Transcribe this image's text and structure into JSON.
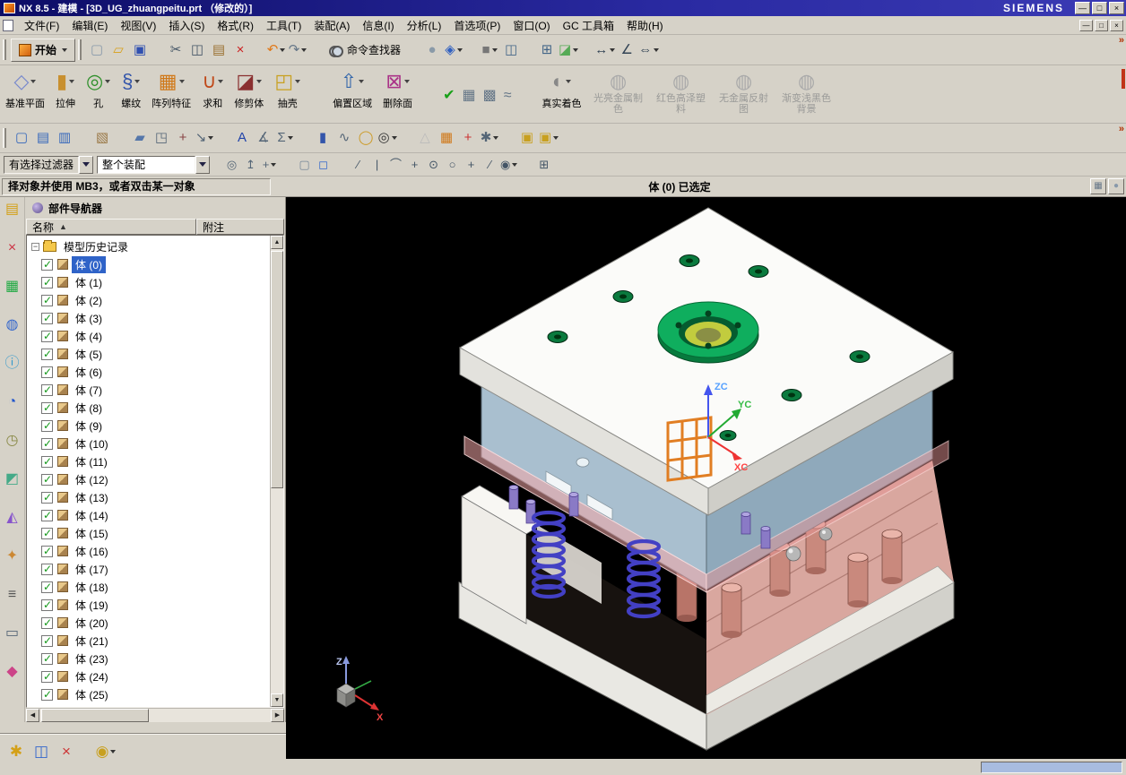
{
  "titlebar": {
    "title": "NX 8.5 - 建模 - [3D_UG_zhuangpeitu.prt （修改的）]",
    "brand": "SIEMENS",
    "minimize_glyph": "—",
    "maximize_glyph": "□",
    "close_glyph": "×"
  },
  "mdi": {
    "minimize_glyph": "—",
    "restore_glyph": "□",
    "close_glyph": "×"
  },
  "chrome": {
    "overflow_glyph": "»"
  },
  "scroll": {
    "up": "▲",
    "down": "▼",
    "left": "◀",
    "right": "▶"
  },
  "menubar": {
    "items": [
      {
        "label": "文件(F)",
        "name": "menu-file"
      },
      {
        "label": "编辑(E)",
        "name": "menu-edit"
      },
      {
        "label": "视图(V)",
        "name": "menu-view"
      },
      {
        "label": "插入(S)",
        "name": "menu-insert"
      },
      {
        "label": "格式(R)",
        "name": "menu-format"
      },
      {
        "label": "工具(T)",
        "name": "menu-tools"
      },
      {
        "label": "装配(A)",
        "name": "menu-assemblies"
      },
      {
        "label": "信息(I)",
        "name": "menu-information"
      },
      {
        "label": "分析(L)",
        "name": "menu-analysis"
      },
      {
        "label": "首选项(P)",
        "name": "menu-preferences"
      },
      {
        "label": "窗口(O)",
        "name": "menu-window"
      },
      {
        "label": "GC 工具箱",
        "name": "menu-gc-toolbox"
      },
      {
        "label": "帮助(H)",
        "name": "menu-help"
      }
    ]
  },
  "standard_toolbar": {
    "start_label": "开始",
    "command_finder_label": "命令查找器",
    "icons_left": [
      {
        "name": "new-file-icon",
        "glyph": "▢",
        "color": "#8899aa"
      },
      {
        "name": "open-folder-icon",
        "glyph": "▱",
        "color": "#d8a018"
      },
      {
        "name": "save-icon",
        "glyph": "▣",
        "color": "#3050b0"
      },
      {
        "name": "cut-icon",
        "glyph": "✂",
        "color": "#445566",
        "gap": true
      },
      {
        "name": "copy-icon",
        "glyph": "◫",
        "color": "#445566"
      },
      {
        "name": "paste-icon",
        "glyph": "▤",
        "color": "#9a7030"
      },
      {
        "name": "delete-icon",
        "glyph": "×",
        "color": "#cc2020"
      },
      {
        "name": "undo-icon",
        "glyph": "↶",
        "color": "#e07818",
        "caret": true,
        "gap": true
      },
      {
        "name": "redo-icon",
        "glyph": "↷",
        "color": "#667788",
        "caret": true
      }
    ],
    "icons_right": [
      {
        "name": "selection-sphere-icon",
        "glyph": "●",
        "color": "#8a9aa8",
        "gap": true
      },
      {
        "name": "view-orient-icon",
        "glyph": "◈",
        "color": "#3060c0",
        "caret": true
      },
      {
        "name": "render-style-icon",
        "glyph": "■",
        "color": "#777777",
        "caret": true,
        "gap": true
      },
      {
        "name": "window-split-icon",
        "glyph": "◫",
        "color": "#446688"
      },
      {
        "name": "fit-view-icon",
        "glyph": "⊞",
        "color": "#446688",
        "gap": true
      },
      {
        "name": "section-view-icon",
        "glyph": "◪",
        "color": "#55aa55",
        "caret": true
      },
      {
        "name": "measure-distance-icon",
        "glyph": "↔",
        "color": "#334455",
        "caret": true,
        "gap": true
      },
      {
        "name": "angle-icon",
        "glyph": "∠",
        "color": "#334455"
      },
      {
        "name": "dimension-icon",
        "glyph": "⇔",
        "color": "#334455",
        "caret": true
      }
    ]
  },
  "feature_toolbar": {
    "buttons": [
      {
        "name": "datum-plane-button",
        "label": "基准平面",
        "glyph": "◇",
        "color": "#7788cc"
      },
      {
        "name": "extrude-button",
        "label": "拉伸",
        "glyph": "▮",
        "color": "#c89030"
      },
      {
        "name": "hole-button",
        "label": "孔",
        "glyph": "◎",
        "color": "#30902c"
      },
      {
        "name": "thread-button",
        "label": "螺纹",
        "glyph": "§",
        "color": "#3355aa"
      },
      {
        "name": "pattern-feature-button",
        "label": "阵列特征",
        "glyph": "▦",
        "color": "#d07818"
      },
      {
        "name": "unite-button",
        "label": "求和",
        "glyph": "∪",
        "color": "#c04818"
      },
      {
        "name": "trim-body-button",
        "label": "修剪体",
        "glyph": "◪",
        "color": "#8a3030"
      },
      {
        "name": "shell-button",
        "label": "抽壳",
        "glyph": "◰",
        "color": "#c8a020"
      },
      {
        "name": "offset-region-button",
        "label": "偏置区域",
        "glyph": "⇧",
        "color": "#3366aa",
        "gap": true
      },
      {
        "name": "delete-face-button",
        "label": "删除面",
        "glyph": "⊠",
        "color": "#aa3388"
      },
      {
        "name": "approve-check-icon",
        "glyph": "✔",
        "color": "#18a018",
        "small": true,
        "gap": true
      },
      {
        "name": "sheet-grid-icon",
        "glyph": "▦",
        "color": "#667788",
        "small": true
      },
      {
        "name": "matrix-icon",
        "glyph": "▩",
        "color": "#667788",
        "small": true
      },
      {
        "name": "curve-group-icon",
        "glyph": "≈",
        "color": "#667788",
        "small": true
      },
      {
        "name": "true-shading-button",
        "label": "真实着色",
        "glyph": "◐",
        "color": "#888888",
        "gap": true
      },
      {
        "name": "metal-material-button",
        "label": "光亮金属制色",
        "glyph": "◍",
        "color": "#9a9a9a",
        "disabled": true
      },
      {
        "name": "red-plastic-button",
        "label": "红色高泽塑料",
        "glyph": "◍",
        "color": "#9a9a9a",
        "disabled": true
      },
      {
        "name": "no-reflection-button",
        "label": "无金属反射图",
        "glyph": "◍",
        "color": "#9a9a9a",
        "disabled": true
      },
      {
        "name": "gradient-background-button",
        "label": "渐变浅黑色背景",
        "glyph": "◍",
        "color": "#9a9a9a",
        "disabled": true
      }
    ]
  },
  "utility_toolbar": {
    "icons": [
      {
        "name": "view-window-icon",
        "glyph": "▢",
        "color": "#3366bb"
      },
      {
        "name": "layer-settings-icon",
        "glyph": "▤",
        "color": "#3366bb"
      },
      {
        "name": "layer-category-icon",
        "glyph": "▥",
        "color": "#3366bb"
      },
      {
        "name": "info-sheet-icon",
        "glyph": "▧",
        "color": "#997744",
        "gap": true
      },
      {
        "name": "plate-icon",
        "glyph": "▰",
        "color": "#5577aa",
        "gap": true
      },
      {
        "name": "crop-icon",
        "glyph": "◳",
        "color": "#556677"
      },
      {
        "name": "datum-small-icon",
        "glyph": "+",
        "color": "#884444"
      },
      {
        "name": "quick-dimension-icon",
        "glyph": "↘",
        "color": "#556677",
        "caret": true
      },
      {
        "name": "annotation-icon",
        "glyph": "A",
        "color": "#2244aa",
        "gap": true
      },
      {
        "name": "slope-icon",
        "glyph": "∡",
        "color": "#556677"
      },
      {
        "name": "sigma-grid-icon",
        "glyph": "Σ",
        "color": "#556677",
        "caret": true
      },
      {
        "name": "cylinder-icon",
        "glyph": "▮",
        "color": "#3355aa",
        "gap": true
      },
      {
        "name": "spring-icon",
        "glyph": "∿",
        "color": "#556677"
      },
      {
        "name": "torus-icon",
        "glyph": "◯",
        "color": "#cc9922"
      },
      {
        "name": "spiral-icon",
        "glyph": "◎",
        "color": "#333333",
        "caret": true
      },
      {
        "name": "triangle-mesh-icon",
        "glyph": "△",
        "color": "#bbbbbb",
        "gap": true
      },
      {
        "name": "table-icon",
        "glyph": "▦",
        "color": "#d07818"
      },
      {
        "name": "plus-red-icon",
        "glyph": "+",
        "color": "#cc3333"
      },
      {
        "name": "gears-icon",
        "glyph": "✱",
        "color": "#556677",
        "caret": true
      },
      {
        "name": "component-box-icon",
        "glyph": "▣",
        "color": "#c8a020",
        "gap": true
      },
      {
        "name": "component-box2-icon",
        "glyph": "▣",
        "color": "#c8a020",
        "caret": true
      }
    ]
  },
  "selection_bar": {
    "filter_label": "有选择过滤器",
    "scope_value": "整个装配",
    "icons": [
      {
        "name": "glasses-icon",
        "glyph": "◎",
        "color": "#556677"
      },
      {
        "name": "pick-top-icon",
        "glyph": "↥",
        "color": "#556677"
      },
      {
        "name": "crosshair-icon",
        "glyph": "+",
        "color": "#556677",
        "caret": true
      },
      {
        "name": "rounded-rect-icon",
        "glyph": "▢",
        "color": "#778899",
        "gap": true
      },
      {
        "name": "face-select-icon",
        "glyph": "◻",
        "color": "#3366cc"
      },
      {
        "name": "line-snap-icon",
        "glyph": "∕",
        "color": "#445566",
        "gap": true
      },
      {
        "name": "endpoint-snap-icon",
        "glyph": "|",
        "color": "#445566"
      },
      {
        "name": "arc-snap-icon",
        "glyph": "⌒",
        "color": "#445566"
      },
      {
        "name": "intersection-snap-icon",
        "glyph": "+",
        "color": "#445566"
      },
      {
        "name": "center-snap-icon",
        "glyph": "⊙",
        "color": "#445566"
      },
      {
        "name": "circle-snap-icon",
        "glyph": "○",
        "color": "#445566"
      },
      {
        "name": "point-snap-icon",
        "glyph": "+",
        "color": "#445566"
      },
      {
        "name": "tangent-snap-icon",
        "glyph": "∕",
        "color": "#445566"
      },
      {
        "name": "sphere-snap-icon",
        "glyph": "◉",
        "color": "#445566",
        "caret": true
      },
      {
        "name": "grid-snap-icon",
        "glyph": "⊞",
        "color": "#445566",
        "gap": true
      }
    ]
  },
  "prompt_bar": {
    "message": "择对象并使用 MB3，或者双击某一对象",
    "status": "体 (0) 已选定"
  },
  "dock": {
    "icons": [
      {
        "name": "assembly-navigator-icon",
        "glyph": "▤",
        "color": "#d4a017"
      },
      {
        "name": "constraint-navigator-icon",
        "glyph": "×",
        "color": "#cc3344"
      },
      {
        "name": "part-navigator-icon",
        "glyph": "▦",
        "color": "#22aa44"
      },
      {
        "name": "reuse-library-icon",
        "glyph": "◍",
        "color": "#3366cc"
      },
      {
        "name": "hd3d-tool-icon",
        "glyph": "ⓘ",
        "color": "#3399cc"
      },
      {
        "name": "web-browser-icon",
        "glyph": "◔",
        "color": "#2255cc"
      },
      {
        "name": "history-palette-icon",
        "glyph": "◷",
        "color": "#888844"
      },
      {
        "name": "system-materials-icon",
        "glyph": "◩",
        "color": "#44aa88"
      },
      {
        "name": "process-studio-icon",
        "glyph": "◭",
        "color": "#8855cc"
      },
      {
        "name": "machining-wizard-icon",
        "glyph": "✦",
        "color": "#cc8833"
      },
      {
        "name": "roles-icon",
        "glyph": "≡",
        "color": "#555555"
      },
      {
        "name": "touch-panel-icon",
        "glyph": "▭",
        "color": "#556677"
      },
      {
        "name": "visualization-scene-icon",
        "glyph": "◆",
        "color": "#cc4488"
      }
    ]
  },
  "navigator": {
    "title": "部件导航器",
    "col_name": "名称",
    "sort_indicator": "▲",
    "col_note": "附注",
    "root_label": "模型历史记录",
    "items": [
      {
        "label": "体 (0)",
        "selected": true
      },
      {
        "label": "体 (1)"
      },
      {
        "label": "体 (2)"
      },
      {
        "label": "体 (3)"
      },
      {
        "label": "体 (4)"
      },
      {
        "label": "体 (5)"
      },
      {
        "label": "体 (6)"
      },
      {
        "label": "体 (7)"
      },
      {
        "label": "体 (8)"
      },
      {
        "label": "体 (9)"
      },
      {
        "label": "体 (10)"
      },
      {
        "label": "体 (11)"
      },
      {
        "label": "体 (12)"
      },
      {
        "label": "体 (13)"
      },
      {
        "label": "体 (14)"
      },
      {
        "label": "体 (15)"
      },
      {
        "label": "体 (16)"
      },
      {
        "label": "体 (17)"
      },
      {
        "label": "体 (18)"
      },
      {
        "label": "体 (19)"
      },
      {
        "label": "体 (20)"
      },
      {
        "label": "体 (21)"
      },
      {
        "label": "体 (23)"
      },
      {
        "label": "体 (24)"
      },
      {
        "label": "体 (25)"
      }
    ]
  },
  "viewport": {
    "triad_z": "ZC",
    "triad_y": "YC",
    "triad_x": "XC",
    "mini_z": "Z",
    "mini_x": "X",
    "colors": {
      "axis_x": "#ee3333",
      "axis_y": "#22aa33",
      "axis_z": "#4455ee",
      "ring_green": "#0fae5e",
      "plate_blue": "#a9bfcf",
      "plate_pink": "#f2a6a6",
      "wcs_orange": "#e07818"
    }
  },
  "footer": {
    "icons": [
      {
        "name": "star-new-icon",
        "glyph": "✱",
        "color": "#d4a017"
      },
      {
        "name": "cascade-windows-icon",
        "glyph": "◫",
        "color": "#3366cc"
      },
      {
        "name": "swap-layout-icon",
        "glyph": "×",
        "color": "#cc3333"
      },
      {
        "name": "customize-gears-icon",
        "glyph": "◉",
        "color": "#c8a020",
        "caret": true,
        "gap": true
      }
    ]
  },
  "prompt_right_icons": [
    {
      "name": "palette-icon",
      "glyph": "▦",
      "color": "#667788"
    },
    {
      "name": "ball-bar-icon",
      "glyph": "●",
      "color": "#8899aa"
    }
  ]
}
